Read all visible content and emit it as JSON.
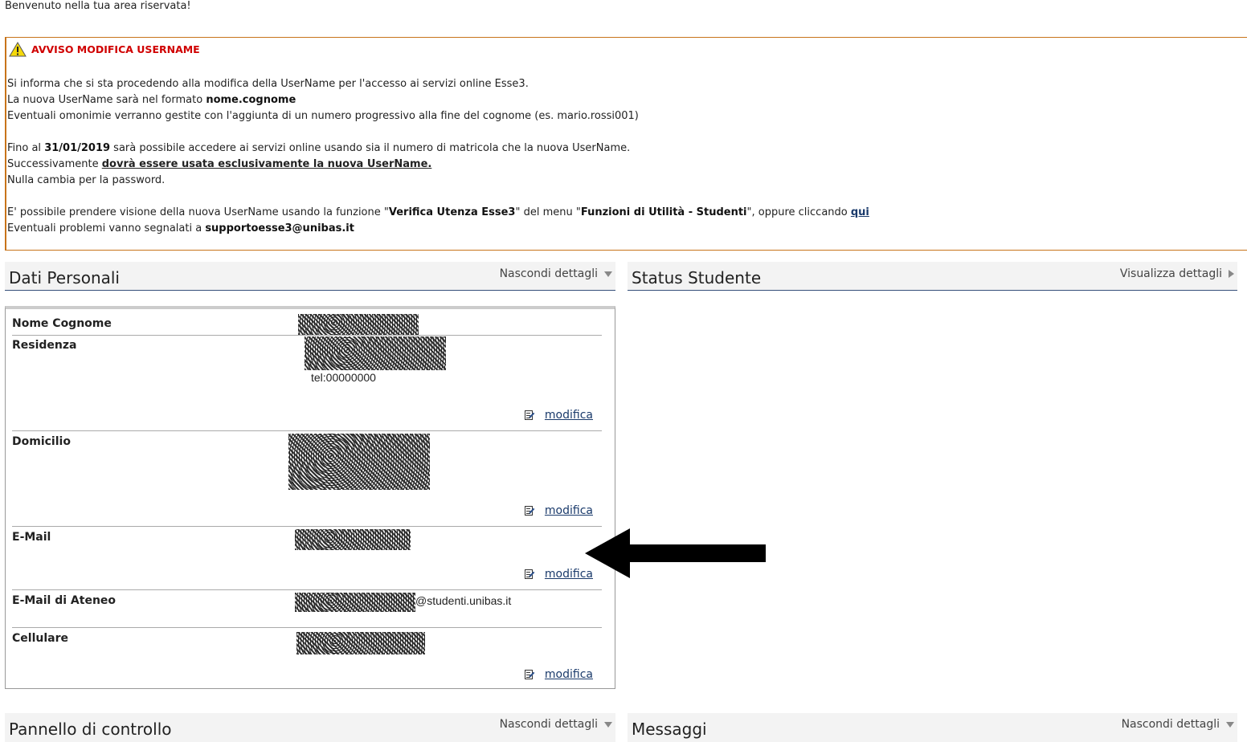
{
  "welcome": "Benvenuto nella tua area riservata!",
  "notice": {
    "title": "AVVISO MODIFICA USERNAME",
    "line1": "Si informa che si sta procedendo alla modifica della UserName per l'accesso ai servizi online Esse3.",
    "line2_pre": "La nuova UserName sarà nel formato ",
    "line2_bold": "nome.cognome",
    "line3": "Eventuali omonimie verranno gestite con l'aggiunta di un numero progressivo alla fine del cognome (es. mario.rossi001)",
    "line4_pre": "Fino al ",
    "line4_bold": "31/01/2019",
    "line4_post": " sarà possibile accedere ai servizi online usando sia il numero di matricola che la nuova UserName.",
    "line5_pre": "Successivamente ",
    "line5_bold": "dovrà essere usata esclusivamente la nuova UserName.",
    "line6": "Nulla cambia per la password.",
    "line7_pre": "E' possibile prendere visione della nuova UserName usando la funzione \"",
    "line7_b1": "Verifica Utenza Esse3",
    "line7_mid": "\" del menu \"",
    "line7_b2": "Funzioni di Utilità - Studenti",
    "line7_post": "\", oppure cliccando ",
    "line7_link": "qui",
    "line8_pre": "Eventuali problemi vanno segnalati a ",
    "line8_bold": "supportoesse3@unibas.it"
  },
  "panels": {
    "dati": {
      "title": "Dati Personali",
      "toggle": "Nascondi dettagli"
    },
    "status": {
      "title": "Status Studente",
      "toggle": "Visualizza dettagli"
    },
    "pannello": {
      "title": "Pannello di controllo",
      "toggle": "Nascondi dettagli"
    },
    "messaggi": {
      "title": "Messaggi",
      "toggle": "Nascondi dettagli"
    }
  },
  "dati_rows": {
    "nome": {
      "label": "Nome Cognome"
    },
    "residenza": {
      "label": "Residenza",
      "tel": "tel:00000000",
      "edit": "modifica"
    },
    "domicilio": {
      "label": "Domicilio",
      "edit": "modifica"
    },
    "email": {
      "label": "E-Mail",
      "edit": "modifica"
    },
    "email_ateneo": {
      "label": "E-Mail di Ateneo",
      "value_suffix": "@studenti.unibas.it"
    },
    "cellulare": {
      "label": "Cellulare",
      "edit": "modifica"
    }
  }
}
